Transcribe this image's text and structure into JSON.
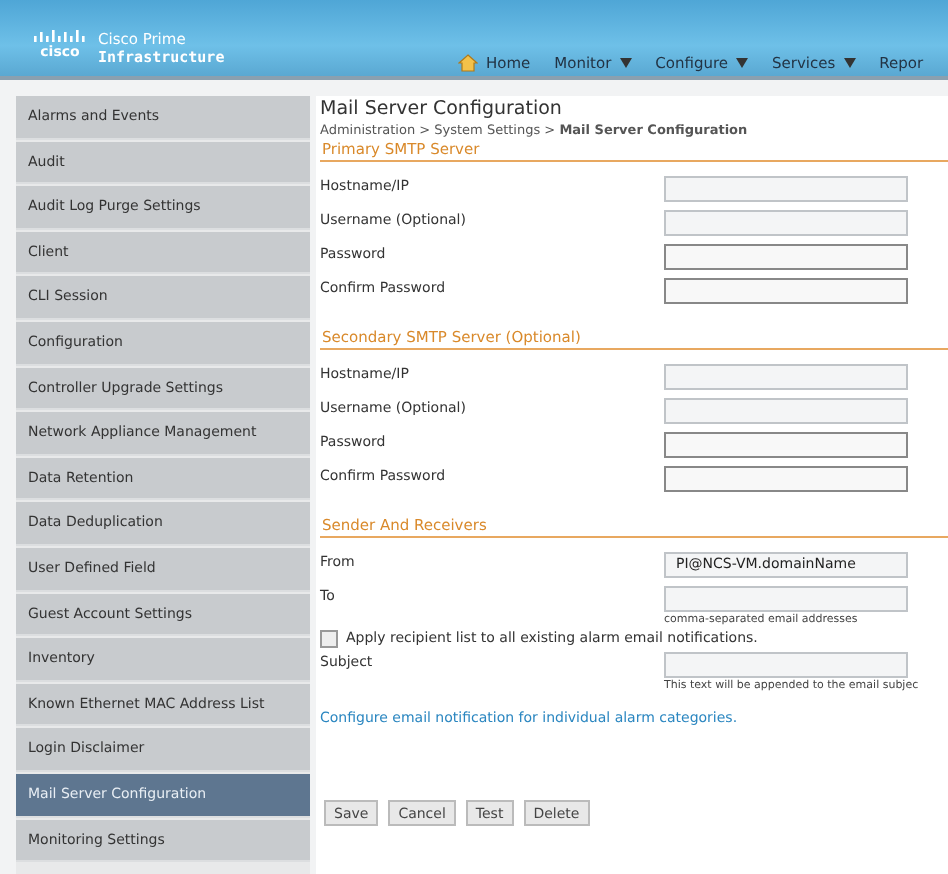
{
  "header": {
    "brand": "cisco",
    "product": "Cisco Prime",
    "product_bold": "Infrastructure",
    "nav": [
      {
        "label": "Home",
        "kind": "home"
      },
      {
        "label": "Monitor",
        "kind": "menu"
      },
      {
        "label": "Configure",
        "kind": "menu"
      },
      {
        "label": "Services",
        "kind": "menu"
      },
      {
        "label": "Repor",
        "kind": "plain"
      }
    ]
  },
  "sidebar": {
    "items": [
      {
        "label": "Alarms and Events",
        "selected": false
      },
      {
        "label": "Audit",
        "selected": false
      },
      {
        "label": "Audit Log Purge Settings",
        "selected": false
      },
      {
        "label": "Client",
        "selected": false
      },
      {
        "label": "CLI Session",
        "selected": false
      },
      {
        "label": "Configuration",
        "selected": false
      },
      {
        "label": "Controller Upgrade Settings",
        "selected": false
      },
      {
        "label": "Network Appliance Management",
        "selected": false
      },
      {
        "label": "Data Retention",
        "selected": false
      },
      {
        "label": "Data Deduplication",
        "selected": false
      },
      {
        "label": "User Defined Field",
        "selected": false
      },
      {
        "label": "Guest Account Settings",
        "selected": false
      },
      {
        "label": "Inventory",
        "selected": false
      },
      {
        "label": "Known Ethernet MAC Address List",
        "selected": false
      },
      {
        "label": "Login Disclaimer",
        "selected": false
      },
      {
        "label": "Mail Server Configuration",
        "selected": true
      },
      {
        "label": "Monitoring Settings",
        "selected": false
      }
    ]
  },
  "page": {
    "title": "Mail Server Configuration",
    "breadcrumb": "Administration > System Settings > **Mail Server Configuration**",
    "sections": [
      {
        "heading": "Primary SMTP Server",
        "rows": [
          {
            "label": "Hostname/IP",
            "kind": "text"
          },
          {
            "label": "Username (Optional)",
            "kind": "text"
          },
          {
            "label": "Password",
            "kind": "password"
          },
          {
            "label": "Confirm Password",
            "kind": "password"
          }
        ]
      },
      {
        "heading": "Secondary SMTP Server (Optional)",
        "rows": [
          {
            "label": "Hostname/IP",
            "kind": "text"
          },
          {
            "label": "Username (Optional)",
            "kind": "text"
          },
          {
            "label": "Password",
            "kind": "password"
          },
          {
            "label": "Confirm Password",
            "kind": "password"
          }
        ]
      },
      {
        "heading": "Sender And Receivers",
        "rows": [
          {
            "label": "From",
            "kind": "text",
            "value": "PI@NCS-VM.domainName"
          },
          {
            "label": "To",
            "kind": "text",
            "hint": "comma-separated email addresses"
          },
          {
            "label": "Apply recipient list to all existing alarm email notifications.",
            "kind": "checkbox",
            "checked": false
          },
          {
            "label": "Subject",
            "kind": "text",
            "hint": "This text will be appended to the email subjec"
          }
        ]
      }
    ],
    "link": "Configure email notification for individual alarm categories.",
    "buttons": [
      "Save",
      "Cancel",
      "Test",
      "Delete"
    ]
  }
}
